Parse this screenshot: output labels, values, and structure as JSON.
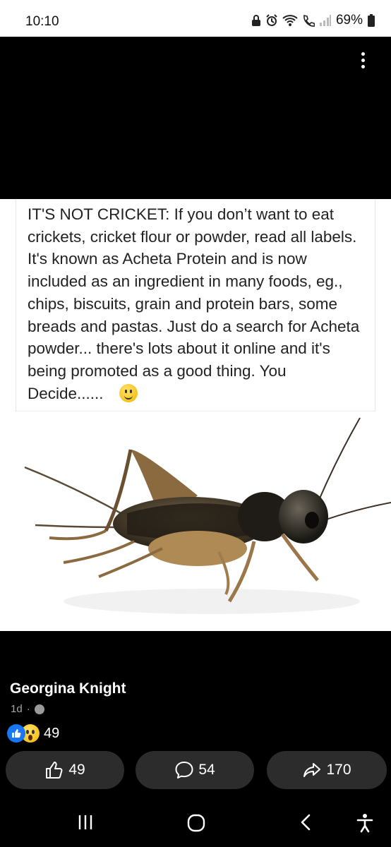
{
  "status_bar": {
    "time": "10:10",
    "battery_percent": "69%",
    "icons": [
      "lock-icon",
      "alarm-icon",
      "wifi-icon",
      "call-icon",
      "signal-icon",
      "battery-icon"
    ]
  },
  "post": {
    "caption": "IT'S NOT CRICKET:     If you don’t want to eat crickets, cricket flour or powder, read all labels. It's known as Acheta Protein and is now included as an ingredient in many foods, eg., chips, biscuits, grain and protein bars,  some breads and pastas. Just do a search for Acheta powder... there's lots about it online and it's being promoted as a good thing. You Decide......",
    "author": "Georgina Knight",
    "time_ago": "1d",
    "meta_separator": "·",
    "reactions_count": "49"
  },
  "actions": {
    "like_count": "49",
    "comment_count": "54",
    "share_count": "170"
  },
  "navbar": {
    "items": [
      "recents-icon",
      "home-icon",
      "back-icon",
      "accessibility-icon"
    ]
  }
}
